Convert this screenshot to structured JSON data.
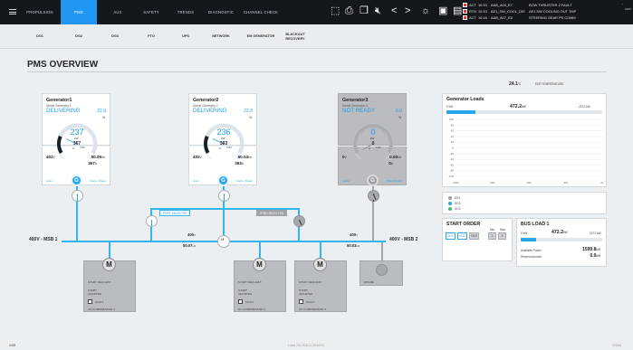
{
  "topnav": {
    "menu_icon": "hamburger-menu-icon",
    "tabs": [
      "PROPULSION",
      "PMS",
      "AUX",
      "SAFETY",
      "TRENDS",
      "DIAGNOSTIC",
      "CHANNEL CHECK"
    ],
    "icons": [
      "screen-select-icon",
      "print-icon",
      "copy-icon",
      "mute-icon",
      "back-arrow-icon",
      "forward-arrow-icon",
      "brightness-icon",
      "display-icon",
      "screen-icon"
    ],
    "alarms": [
      {
        "status": "ACT",
        "time": "10:33",
        "tag": "AAB_A04_E7",
        "text": "BOW THRUSTER 2 FAULT"
      },
      {
        "status": "RTN",
        "time": "10:33",
        "tag": "AE1_SW_COOL_DIS",
        "text": "AE1 SW COOLING OUT TMP"
      },
      {
        "status": "ACT",
        "time": "10:16",
        "tag": "AAB_A07_E6",
        "text": "STEERING GEAR PS COMM"
      }
    ],
    "alarm_side": "SHIP"
  },
  "subnav": {
    "tabs": [
      "DG1",
      "DG2",
      "DG3",
      "PTO",
      "UPS",
      "NETWORK",
      "EM GENERATOR",
      "BLACKOUT RECOVERY"
    ]
  },
  "page": {
    "title": "PMS OVERVIEW"
  },
  "temperature": {
    "value": "24.1",
    "unit": "°C",
    "label": "ECR TEMPERATURE"
  },
  "generators": [
    {
      "name": "Generator1",
      "sub": "Diesel Generator 1",
      "state": "DELIVERING",
      "pct": "22.6",
      "pct_unit": "%",
      "gauge_value": "237",
      "gauge_unit": "kW",
      "gauge_amp": "367",
      "gauge_amp_unit": "A",
      "gauge_max": "1050",
      "voltage": "402",
      "voltage_unit": "V",
      "freq": "50.05",
      "freq_unit": "Hz",
      "amps": "367",
      "amps_unit": "A",
      "mode": "Auto",
      "droop": "Comp. Droop",
      "icon_letter": "G",
      "level": 0.226,
      "color": "#1e9be8"
    },
    {
      "name": "Generator2",
      "sub": "Diesel Generator 2",
      "state": "DELIVERING",
      "pct": "22.6",
      "pct_unit": "%",
      "gauge_value": "236",
      "gauge_unit": "kW",
      "gauge_amp": "393",
      "gauge_amp_unit": "A",
      "gauge_max": "1050",
      "voltage": "402",
      "voltage_unit": "V",
      "freq": "50.04",
      "freq_unit": "Hz",
      "amps": "393",
      "amps_unit": "A",
      "mode": "Auto",
      "droop": "Comp. Droop",
      "icon_letter": "G",
      "level": 0.226,
      "color": "#1e9be8"
    },
    {
      "name": "Generator3",
      "sub": "Diesel Generator 3",
      "state": "NOT READY",
      "pct": "0.0",
      "pct_unit": "%",
      "gauge_value": "0",
      "gauge_unit": "kW",
      "gauge_amp": "0",
      "gauge_amp_unit": "A",
      "gauge_max": "1050",
      "voltage": "0",
      "voltage_unit": "V",
      "freq": "0.00",
      "freq_unit": "Hz",
      "amps": "0",
      "amps_unit": "A",
      "mode": "Local",
      "droop": "Fixed Droop",
      "icon_letter": "G",
      "level": 0,
      "color": "#1e9be8"
    }
  ],
  "busbars": {
    "msb1_label": "400V - MSB 1",
    "msb2_label": "400V - MSB 2",
    "port_selected": "PORT SELECTED",
    "stbd_selected": "STBD SELECTED",
    "msb1_v": "400",
    "msb1_v_unit": "V",
    "msb1_hz": "50.07",
    "msb1_hz_unit": "Hz",
    "msb2_v": "400",
    "msb2_v_unit": "V",
    "msb2_hz": "50.03",
    "msb2_hz_unit": "Hz",
    "motor_letter": "M"
  },
  "consumers": [
    {
      "letter": "M",
      "line1": "START REQUEST",
      "line2": "START GRANTED",
      "fault": "FAULT",
      "name": "AC COMPRESSOR 1"
    },
    {
      "letter": "M",
      "line1": "START REQUEST",
      "line2": "START GRANTED",
      "fault": "FAULT",
      "name": "AC COMPRESSOR 2"
    },
    {
      "letter": "M",
      "line1": "START REQUEST",
      "line2": "START GRANTED",
      "fault": "FAULT",
      "name": "AC COMPRESSOR 3"
    },
    {
      "letter": "",
      "line1": "SHORE",
      "line2": "",
      "fault": "",
      "name": ""
    }
  ],
  "gen_loads": {
    "title": "Generator Loads",
    "unit_left": "0 kW",
    "value": "472.2",
    "value_unit": "kW",
    "max": "2472 kW",
    "y_ticks": [
      "100",
      "80",
      "60",
      "40",
      "20",
      "0",
      "-20",
      "-40",
      "-60",
      "-80",
      "-100"
    ],
    "x_ticks": [
      "-120s",
      "-90s",
      "-60s",
      "-30s",
      "0s"
    ],
    "legend": [
      "DG1",
      "DG2",
      "DG3"
    ],
    "legend_colors": [
      "#9aa0a6",
      "#2ba6ea",
      "#43c463"
    ]
  },
  "start_order": {
    "title": "START ORDER",
    "buttons": [
      "DG1",
      "DG2",
      "DG3"
    ],
    "min_label": "Min.",
    "max_label": "Max.",
    "min": "2",
    "max": "3"
  },
  "bus_load": {
    "title": "BUS LOAD 1",
    "unit_left": "0 kW",
    "value": "472.2",
    "value_unit": "kW",
    "max": "2472 kW",
    "level": 0.19,
    "avail_label": "Available Power",
    "avail": "1599.8",
    "avail_unit": "kW",
    "reserved_label": "Reserved power",
    "reserved": "0.0",
    "reserved_unit": "kW"
  },
  "footer": {
    "left": "ABB",
    "center": "Local  2017/03/14 09:43:51",
    "right": "CONN"
  }
}
